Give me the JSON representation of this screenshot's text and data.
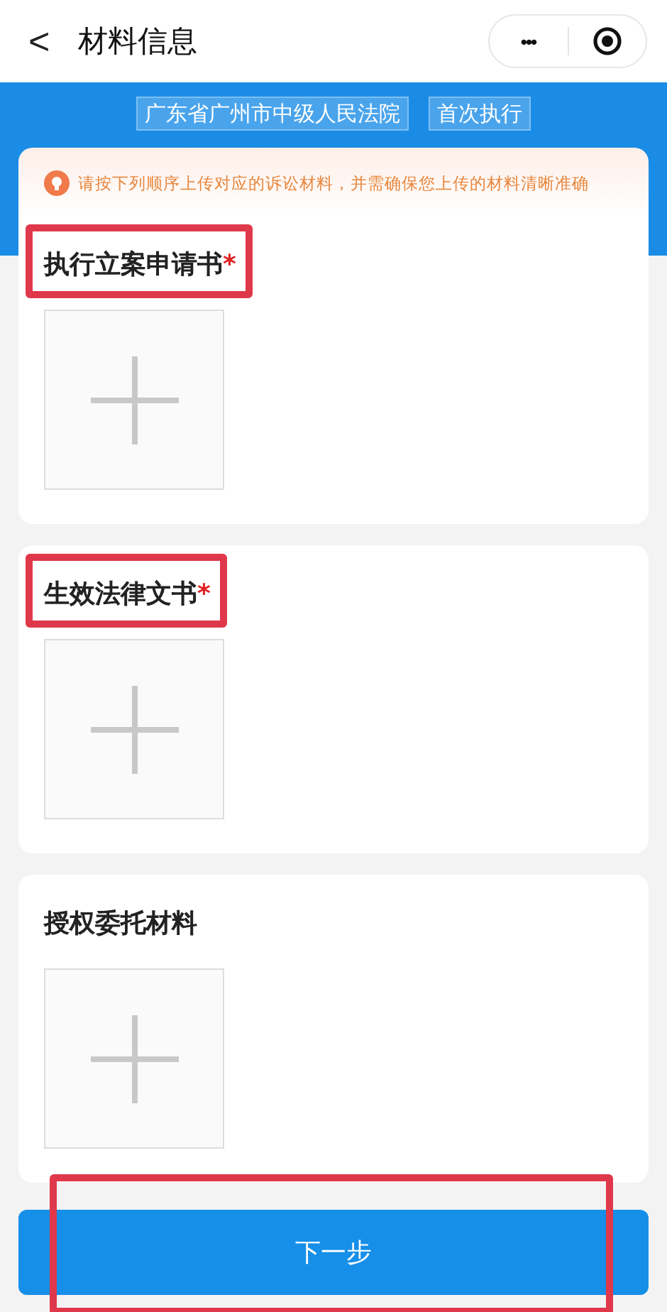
{
  "nav": {
    "back": "<",
    "title": "材料信息",
    "more": "•••"
  },
  "tags": [
    "广东省广州市中级人民法院",
    "首次执行"
  ],
  "notice": "请按下列顺序上传对应的诉讼材料，并需确保您上传的材料清晰准确",
  "sections": [
    {
      "title": "执行立案申请书",
      "required_mark": "*",
      "highlighted": true
    },
    {
      "title": "生效法律文书",
      "required_mark": "*",
      "highlighted": true
    },
    {
      "title": "授权委托材料",
      "highlighted": false
    }
  ],
  "next_button": {
    "label": "下一步",
    "highlighted": true
  }
}
